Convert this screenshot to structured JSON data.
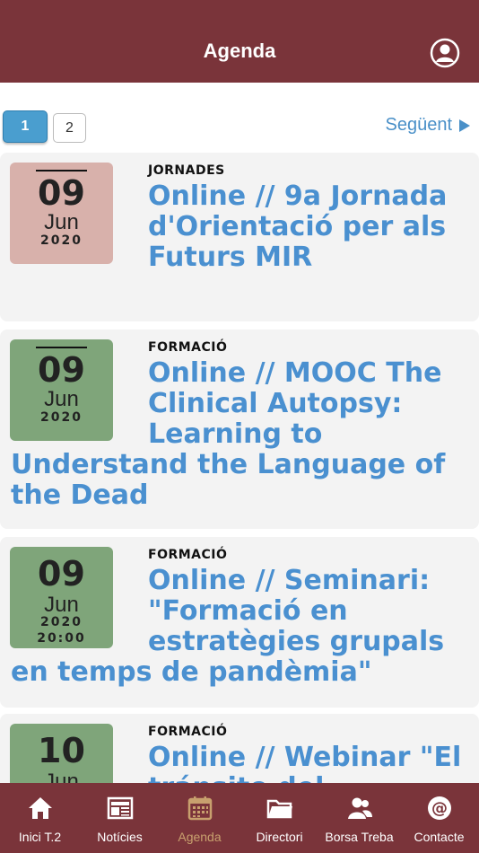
{
  "header": {
    "title": "Agenda",
    "user_icon": "user-circle-icon"
  },
  "pager": {
    "pages": [
      "1",
      "2"
    ],
    "current": "1",
    "next_label": "Següent"
  },
  "events": [
    {
      "day": "09",
      "month": "Jun",
      "year": "2020",
      "time": "",
      "category": "JORNADES",
      "title": "Online // 9a Jornada d'Orientació per als Futurs MIR",
      "date_color": "#d8b1ab"
    },
    {
      "day": "09",
      "month": "Jun",
      "year": "2020",
      "time": "",
      "category": "FORMACIÓ",
      "title": "Online // MOOC The Clinical Autopsy: Learning to Understand the Language of the Dead",
      "date_color": "#7fa57a"
    },
    {
      "day": "09",
      "month": "Jun",
      "year": "2020",
      "time": "20:00",
      "category": "FORMACIÓ",
      "title": "Online // Seminari: \"Formació en estratègies grupals en temps de pandèmia\"",
      "date_color": "#7fa57a"
    },
    {
      "day": "10",
      "month": "Jun",
      "year": "",
      "time": "",
      "category": "FORMACIÓ",
      "title": "Online // Webinar \"El tránsito del",
      "date_color": "#7fa57a"
    }
  ],
  "tabbar": {
    "tabs": [
      {
        "label": "Inici T.2",
        "icon": "home-icon"
      },
      {
        "label": "Notícies",
        "icon": "newspaper-icon"
      },
      {
        "label": "Agenda",
        "icon": "calendar-icon",
        "active": true
      },
      {
        "label": "Directori",
        "icon": "folder-icon"
      },
      {
        "label": "Borsa Treba",
        "icon": "people-icon"
      },
      {
        "label": "Contacte",
        "icon": "at-icon"
      }
    ]
  },
  "colors": {
    "brand": "#7a343a",
    "link": "#4a90d0",
    "active_tab": "#c8a06e"
  }
}
